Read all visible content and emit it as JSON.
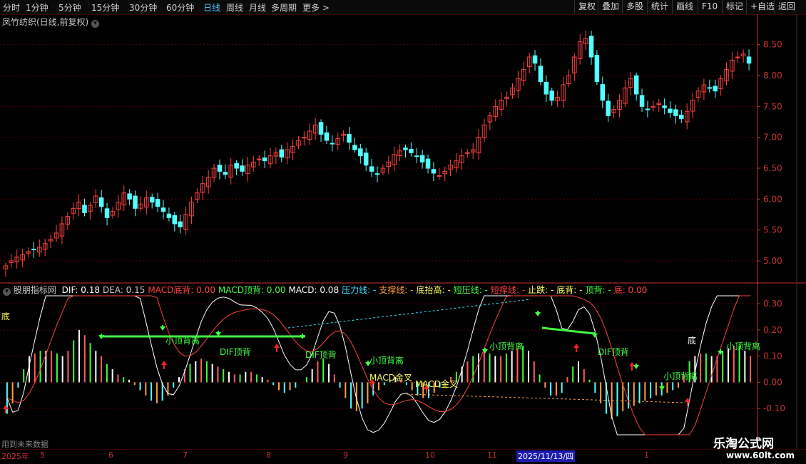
{
  "toolbar": {
    "timeframes": [
      "分时",
      "1分钟",
      "5分钟",
      "15分钟",
      "30分钟",
      "60分钟",
      "日线",
      "周线",
      "月线",
      "多周期",
      "更多 >"
    ],
    "active_timeframe": "日线",
    "right_buttons": [
      "复权",
      "叠加",
      "多股",
      "统计",
      "画线",
      "F10",
      "标记",
      "+自选",
      "返回"
    ]
  },
  "main_chart": {
    "title": "凤竹纺织(日线,前复权)",
    "y_ticks": [
      "8.50",
      "8.00",
      "7.50",
      "7.00",
      "6.50",
      "6.00",
      "5.50",
      "5.00"
    ],
    "y_range": [
      4.7,
      8.9
    ],
    "candles_close": [
      4.92,
      5.0,
      5.06,
      5.1,
      5.15,
      5.18,
      5.22,
      5.28,
      5.35,
      5.45,
      5.6,
      5.72,
      5.85,
      5.95,
      5.78,
      5.9,
      6.05,
      5.88,
      5.7,
      5.8,
      5.95,
      6.1,
      6.0,
      5.85,
      5.92,
      6.02,
      5.95,
      5.88,
      5.8,
      5.7,
      5.6,
      5.55,
      5.75,
      5.95,
      6.1,
      6.25,
      6.35,
      6.5,
      6.45,
      6.4,
      6.55,
      6.5,
      6.45,
      6.55,
      6.6,
      6.65,
      6.62,
      6.7,
      6.75,
      6.68,
      6.8,
      6.85,
      6.95,
      7.0,
      7.1,
      7.2,
      7.05,
      6.95,
      6.9,
      6.98,
      7.05,
      6.92,
      6.8,
      6.7,
      6.55,
      6.45,
      6.4,
      6.5,
      6.6,
      6.72,
      6.78,
      6.8,
      6.75,
      6.7,
      6.6,
      6.5,
      6.42,
      6.38,
      6.45,
      6.55,
      6.62,
      6.7,
      6.75,
      6.8,
      7.0,
      7.2,
      7.35,
      7.5,
      7.6,
      7.65,
      7.8,
      7.95,
      8.1,
      8.3,
      8.2,
      7.9,
      7.7,
      7.6,
      7.65,
      7.85,
      8.0,
      8.3,
      8.55,
      8.6,
      8.3,
      7.9,
      7.6,
      7.35,
      7.45,
      7.6,
      7.8,
      7.95,
      7.7,
      7.5,
      7.45,
      7.5,
      7.55,
      7.48,
      7.4,
      7.35,
      7.3,
      7.42,
      7.6,
      7.75,
      7.85,
      7.8,
      7.75,
      7.95,
      8.1,
      8.25,
      8.3,
      8.35,
      8.2
    ],
    "candle_colors": {
      "up": "#ff4040",
      "down": "#54ffff"
    }
  },
  "indicator": {
    "name": "股朋指标网",
    "labels": [
      {
        "text": "DIF: 0.18",
        "color": "#ffffff"
      },
      {
        "text": "DEA: 0.15",
        "color": "#c8c8c8"
      },
      {
        "text": "MACD底背: 0.00",
        "color": "#ff4040"
      },
      {
        "text": "MACD顶背: 0.00",
        "color": "#40ff40"
      },
      {
        "text": "MACD: 0.08",
        "color": "#ffffff"
      },
      {
        "text": "压力线: -",
        "color": "#40e0ff"
      },
      {
        "text": "支撑线: -",
        "color": "#ffa040"
      },
      {
        "text": "底抬高: -",
        "color": "#ffff60"
      },
      {
        "text": "短压线: -",
        "color": "#40ff40"
      },
      {
        "text": "短撑线: -",
        "color": "#ff4040"
      },
      {
        "text": "止跌: -",
        "color": "#ffff60"
      },
      {
        "text": "底背: -",
        "color": "#ffff60"
      },
      {
        "text": "顶背: -",
        "color": "#40ff40"
      },
      {
        "text": "底: 0.00",
        "color": "#ff4040"
      }
    ],
    "y_ticks": [
      "0.30",
      "0.20",
      "0.10",
      "0.00",
      "-0.10"
    ],
    "y_range": [
      -0.2,
      0.33
    ],
    "macd_values": [
      -0.12,
      -0.08,
      -0.02,
      0.05,
      0.1,
      0.11,
      0.12,
      0.12,
      0.12,
      0.11,
      0.1,
      0.12,
      0.16,
      0.2,
      0.18,
      0.15,
      0.12,
      0.1,
      0.07,
      0.05,
      0.03,
      0.02,
      0.01,
      -0.01,
      -0.03,
      -0.05,
      -0.07,
      -0.08,
      -0.07,
      -0.05,
      -0.02,
      0.02,
      0.05,
      0.07,
      0.08,
      0.09,
      0.08,
      0.07,
      0.06,
      0.05,
      0.04,
      0.03,
      0.03,
      0.04,
      0.04,
      0.03,
      0.02,
      0.01,
      -0.01,
      -0.03,
      -0.04,
      -0.03,
      -0.02,
      0.0,
      0.02,
      0.05,
      0.08,
      0.09,
      0.07,
      0.03,
      -0.02,
      -0.06,
      -0.1,
      -0.11,
      -0.1,
      -0.08,
      -0.05,
      -0.03,
      -0.01,
      0.01,
      0.02,
      0.01,
      -0.01,
      -0.03,
      -0.05,
      -0.06,
      -0.06,
      -0.04,
      -0.02,
      0.0,
      0.02,
      0.04,
      0.06,
      0.08,
      0.1,
      0.11,
      0.12,
      0.11,
      0.1,
      0.1,
      0.11,
      0.12,
      0.13,
      0.14,
      0.12,
      0.08,
      0.03,
      -0.02,
      -0.05,
      -0.05,
      -0.04,
      0.02,
      0.06,
      0.08,
      0.05,
      0.01,
      -0.04,
      -0.08,
      -0.12,
      -0.14,
      -0.13,
      -0.11,
      -0.1,
      -0.09,
      -0.08,
      -0.07,
      -0.06,
      -0.05,
      -0.05,
      -0.04,
      -0.03,
      -0.02,
      0.03,
      0.08,
      0.1,
      0.11,
      0.11,
      0.1,
      0.1,
      0.12,
      0.13,
      0.14,
      0.14,
      0.12,
      0.1
    ],
    "annotations": [
      {
        "label": "小顶背离",
        "color": "#40ff40"
      },
      {
        "label": "DIF顶背",
        "color": "#40ff40"
      },
      {
        "label": "DIF顶背",
        "color": "#40ff40"
      },
      {
        "label": "小顶背离",
        "color": "#40ff40"
      },
      {
        "label": "MACD金叉",
        "color": "#ffff60"
      },
      {
        "label": "MACD金叉",
        "color": "#ffff60"
      },
      {
        "label": "小顶背离",
        "color": "#40ff40"
      },
      {
        "label": "DIF顶背",
        "color": "#40ff40"
      },
      {
        "label": "小顶背离",
        "color": "#40ff40"
      },
      {
        "label": "小顶背离",
        "color": "#40ff40"
      },
      {
        "label": "底",
        "color": "#ffff60"
      },
      {
        "label": "底",
        "color": "#ffffff"
      }
    ]
  },
  "date_axis": {
    "year_label": "2025年",
    "months": [
      "5",
      "6",
      "7",
      "8",
      "9",
      "10",
      "11",
      "1"
    ],
    "current_date": "2025/11/13/四"
  },
  "footer": {
    "future_note": "用到未来数据",
    "watermark_1": "乐淘公式网",
    "watermark_2": "www.60lt.com"
  },
  "colors": {
    "axis_red": "#c83232",
    "grid": "#5a0000"
  }
}
